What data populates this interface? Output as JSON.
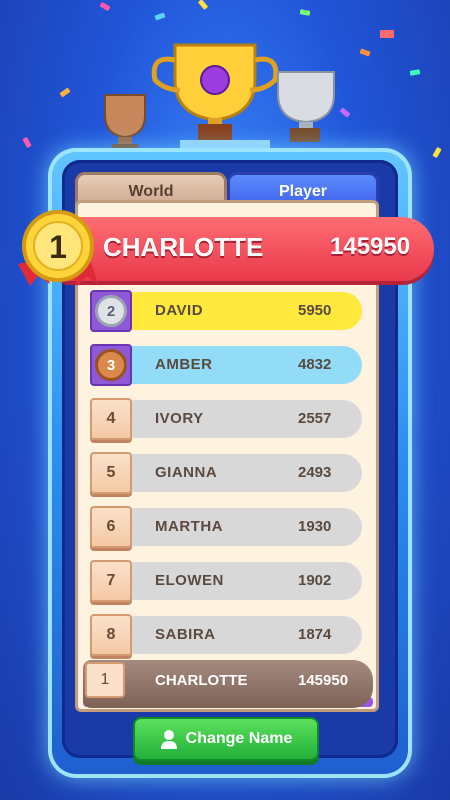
{
  "tabs": [
    {
      "label": "World",
      "active": false
    },
    {
      "label": "Player",
      "active": true
    }
  ],
  "top_player": {
    "rank": "1",
    "name": "CHARLOTTE",
    "score": "145950"
  },
  "leaderboard": [
    {
      "rank": "2",
      "name": "DAVID",
      "score": "5950",
      "medal": "silver"
    },
    {
      "rank": "3",
      "name": "AMBER",
      "score": "4832",
      "medal": "bronze"
    },
    {
      "rank": "4",
      "name": "IVORY",
      "score": "2557"
    },
    {
      "rank": "5",
      "name": "GIANNA",
      "score": "2493"
    },
    {
      "rank": "6",
      "name": "MARTHA",
      "score": "1930"
    },
    {
      "rank": "7",
      "name": "ELOWEN",
      "score": "1902"
    },
    {
      "rank": "8",
      "name": "SABIRA",
      "score": "1874"
    }
  ],
  "own_row": {
    "rank": "1",
    "name": "CHARLOTTE",
    "score": "145950"
  },
  "change_name_button": {
    "label": "Change Name",
    "icon": "user-icon"
  },
  "colors": {
    "background": "#2156d9",
    "banner": "#e8394a",
    "gold_row": "#ffe93c",
    "silver_row": "#93dcf7",
    "button": "#22b13a"
  }
}
